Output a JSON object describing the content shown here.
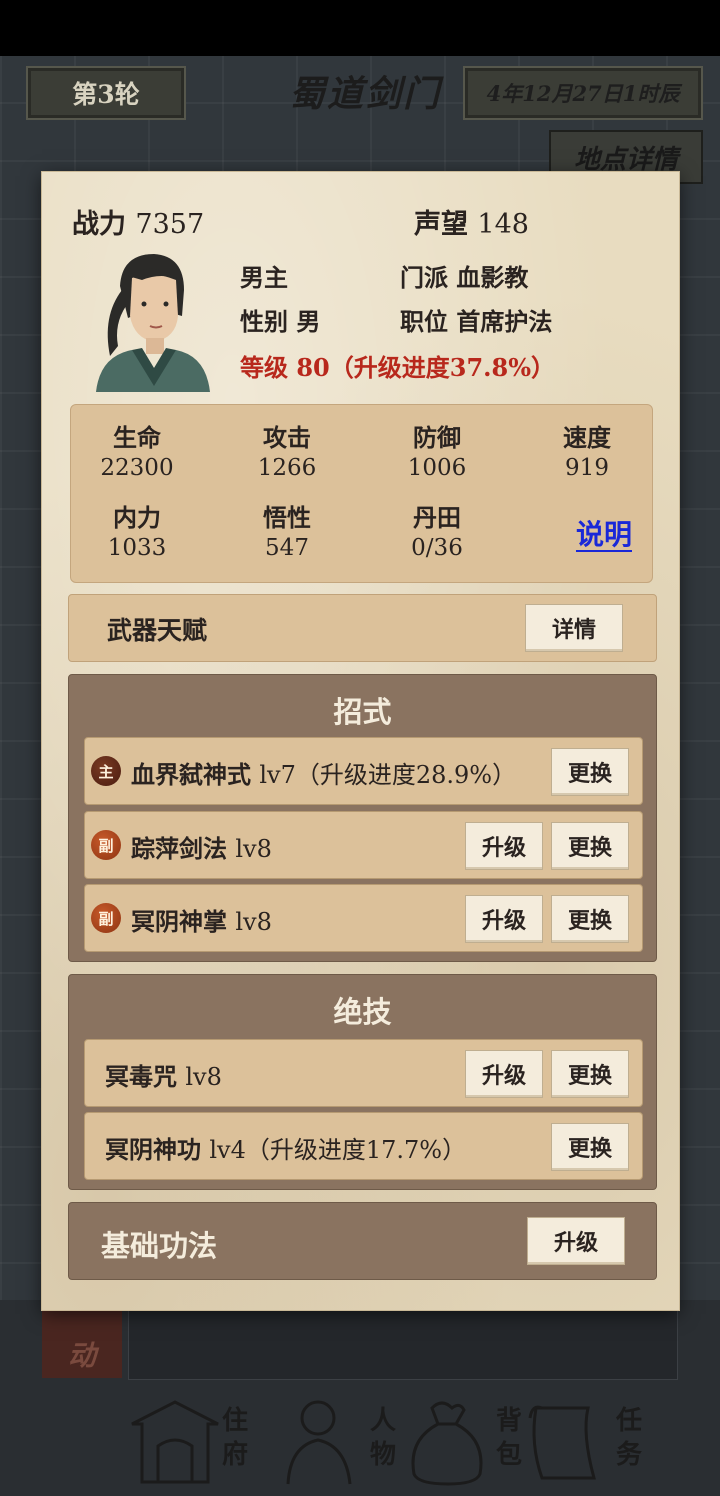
{
  "top_bar": {
    "round": "第3轮",
    "location": "蜀道剑门",
    "date": "4年12月27日1时辰",
    "location_detail": "地点详情"
  },
  "character": {
    "power_label": "战力",
    "power_value": "7357",
    "prestige_label": "声望",
    "prestige_value": "148",
    "name": "男主",
    "gender_label": "性别",
    "gender_value": "男",
    "sect_label": "门派",
    "sect_value": "血影教",
    "position_label": "职位",
    "position_value": "首席护法",
    "level_text": "等级 80（升级进度37.8%）"
  },
  "stats": [
    {
      "label": "生命",
      "value": "22300"
    },
    {
      "label": "攻击",
      "value": "1266"
    },
    {
      "label": "防御",
      "value": "1006"
    },
    {
      "label": "速度",
      "value": "919"
    },
    {
      "label": "内力",
      "value": "1033"
    },
    {
      "label": "悟性",
      "value": "547"
    },
    {
      "label": "丹田",
      "value": "0/36"
    }
  ],
  "explain_link": "说明",
  "weapon": {
    "label": "武器天赋",
    "button": "详情"
  },
  "moves": {
    "title": "招式",
    "items": [
      {
        "badge": "主",
        "name": "血界弑神式",
        "level": "lv7（升级进度28.9%）",
        "replace": "更换"
      },
      {
        "badge": "副",
        "name": "踪萍剑法",
        "level": "lv8",
        "upgrade": "升级",
        "replace": "更换"
      },
      {
        "badge": "副",
        "name": "冥阴神掌",
        "level": "lv8",
        "upgrade": "升级",
        "replace": "更换"
      }
    ]
  },
  "ultimates": {
    "title": "绝技",
    "items": [
      {
        "name": "冥毒咒",
        "level": "lv8",
        "upgrade": "升级",
        "replace": "更换"
      },
      {
        "name": "冥阴神功",
        "level": "lv4（升级进度17.7%）",
        "replace": "更换"
      }
    ]
  },
  "basic": {
    "label": "基础功法",
    "button": "升级"
  },
  "activity_tab": "动",
  "nav": [
    {
      "label": "住府",
      "icon": "house-icon"
    },
    {
      "label": "人物",
      "icon": "person-icon"
    },
    {
      "label": "背包",
      "icon": "bag-icon"
    },
    {
      "label": "任务",
      "icon": "scroll-icon"
    }
  ],
  "colors": {
    "panel_bg": "#e8dcc0",
    "section_bg": "#8a7360",
    "level_red": "#b8281c",
    "link_blue": "#1a28d8"
  }
}
